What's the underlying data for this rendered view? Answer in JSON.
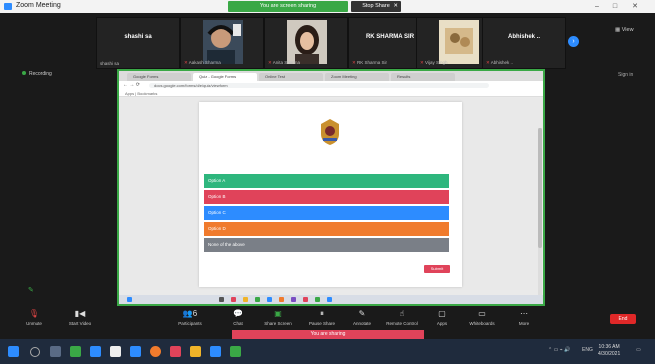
{
  "window": {
    "title": "Zoom Meeting",
    "share_banner": "You are screen sharing",
    "stop_share": "Stop Share",
    "controls": {
      "minimize": "–",
      "maximize": "□",
      "close": "✕"
    }
  },
  "participants": [
    {
      "name": "shashi sa",
      "label": "shashi sa",
      "video": false,
      "muted": false
    },
    {
      "name": "",
      "label": "Aakash Sharma",
      "video": true,
      "muted": true,
      "avatar": "man-with-headphones"
    },
    {
      "name": "",
      "label": "Anita Sharma",
      "video": true,
      "muted": true,
      "avatar": "woman-portrait"
    },
    {
      "name": "RK SHARMA SIR",
      "label": "RK Sharma Sir",
      "video": false,
      "muted": true
    },
    {
      "name": "",
      "label": "Vijay Singh",
      "video": true,
      "muted": true,
      "avatar": "illustration"
    },
    {
      "name": "Abhishek ..",
      "label": "Abhishek ..",
      "video": false,
      "muted": true
    }
  ],
  "view_label": "View",
  "recording_label": "Recording",
  "sign_in_label": "Sign in",
  "browser": {
    "tabs": [
      "Google Forms",
      "Quiz - Google Forms",
      "Online Test",
      "Zoom Meeting",
      "Results"
    ],
    "url": "docs.google.com/forms/d/e/quiz/viewform",
    "bookmarks": "Apps  |  Bookmarks",
    "logo_caption": "",
    "options": [
      {
        "label": "Option A",
        "color": "#2eb67d"
      },
      {
        "label": "Option B",
        "color": "#e0435a"
      },
      {
        "label": "Option C",
        "color": "#2d8cff"
      },
      {
        "label": "Option D",
        "color": "#f07b2d"
      },
      {
        "label": "None of the above",
        "color": "#7a7f87"
      }
    ],
    "submit_label": "Submit"
  },
  "controls": [
    {
      "label": "Unmute",
      "icon": "microphone-icon"
    },
    {
      "label": "Start Video",
      "icon": "video-icon"
    },
    {
      "label": "Participants",
      "icon": "participants-icon",
      "count": "6"
    },
    {
      "label": "Chat",
      "icon": "chat-icon"
    },
    {
      "label": "Share Screen",
      "icon": "share-screen-icon"
    },
    {
      "label": "Pause Share",
      "icon": "pause-share-icon"
    },
    {
      "label": "Annotate",
      "icon": "annotate-icon"
    },
    {
      "label": "Remote Control",
      "icon": "remote-control-icon"
    },
    {
      "label": "Apps",
      "icon": "apps-icon"
    },
    {
      "label": "Whiteboards",
      "icon": "whiteboard-icon"
    },
    {
      "label": "More",
      "icon": "more-icon"
    }
  ],
  "end_label": "End",
  "sharing_notice": "You are sharing",
  "taskbar": {
    "clock_time": "10:36 AM",
    "clock_date": "4/30/2021",
    "lang": "ENG"
  },
  "colors": {
    "zoom_blue": "#2d8cff",
    "share_green": "#3aa846",
    "end_red": "#e02828"
  }
}
